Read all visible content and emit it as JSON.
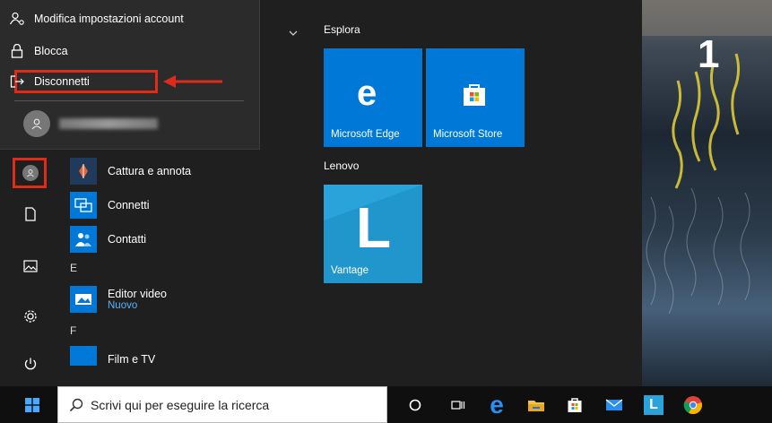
{
  "account_menu": {
    "items": [
      {
        "label": "Modifica impostazioni account",
        "icon": "person-gear-icon"
      },
      {
        "label": "Blocca",
        "icon": "lock-icon"
      },
      {
        "label": "Disconnetti",
        "icon": "sign-out-icon"
      }
    ],
    "user_name": ""
  },
  "app_list": {
    "items": [
      {
        "label": "Cattura e annota",
        "icon": "snip-sketch-icon"
      },
      {
        "label": "Connetti",
        "icon": "connect-icon"
      },
      {
        "label": "Contatti",
        "icon": "people-icon"
      }
    ],
    "section_e": "E",
    "editor": {
      "label": "Editor video",
      "sub": "Nuovo"
    },
    "section_f": "F",
    "film": {
      "label": "Film e TV"
    }
  },
  "tiles": {
    "group1_title": "Esplora",
    "edge_label": "Microsoft Edge",
    "store_label": "Microsoft Store",
    "group2_title": "Lenovo",
    "vantage_label": "Vantage"
  },
  "annotation": {
    "step_number": "1"
  },
  "taskbar": {
    "search_placeholder": "Scrivi qui per eseguire la ricerca"
  },
  "colors": {
    "accent": "#0078d7",
    "highlight": "#e02a1a"
  }
}
